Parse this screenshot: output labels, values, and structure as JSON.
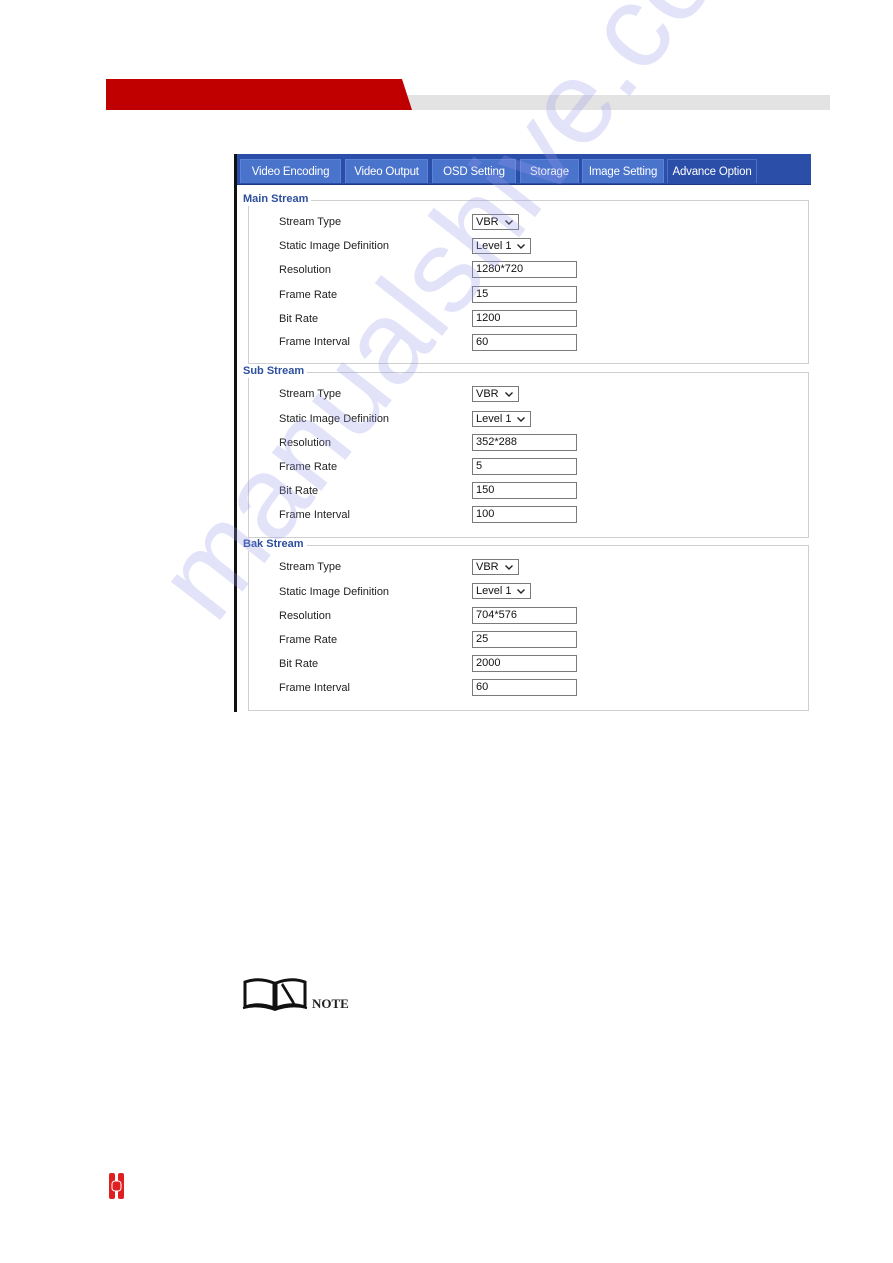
{
  "header": {
    "brand_color": "#c00000",
    "band_color": "#e3e3e3"
  },
  "tabs": [
    {
      "label": "Video Encoding",
      "active": false
    },
    {
      "label": "Video Output",
      "active": false
    },
    {
      "label": "OSD Setting",
      "active": false
    },
    {
      "label": "Storage",
      "active": false
    },
    {
      "label": "Image Setting",
      "active": false
    },
    {
      "label": "Advance Option",
      "active": true
    }
  ],
  "streams": [
    {
      "title": "Main Stream",
      "fields": {
        "stream_type": {
          "label": "Stream Type",
          "value": "VBR"
        },
        "static_image_definition": {
          "label": "Static Image Definition",
          "value": "Level 1"
        },
        "resolution": {
          "label": "Resolution",
          "value": "1280*720"
        },
        "frame_rate": {
          "label": "Frame Rate",
          "value": "15"
        },
        "bit_rate": {
          "label": "Bit Rate",
          "value": "1200"
        },
        "frame_interval": {
          "label": "Frame Interval",
          "value": "60"
        }
      }
    },
    {
      "title": "Sub Stream",
      "fields": {
        "stream_type": {
          "label": "Stream Type",
          "value": "VBR"
        },
        "static_image_definition": {
          "label": "Static Image Definition",
          "value": "Level 1"
        },
        "resolution": {
          "label": "Resolution",
          "value": "352*288"
        },
        "frame_rate": {
          "label": "Frame Rate",
          "value": "5"
        },
        "bit_rate": {
          "label": "Bit Rate",
          "value": "150"
        },
        "frame_interval": {
          "label": "Frame Interval",
          "value": "100"
        }
      }
    },
    {
      "title": "Bak Stream",
      "fields": {
        "stream_type": {
          "label": "Stream Type",
          "value": "VBR"
        },
        "static_image_definition": {
          "label": "Static Image Definition",
          "value": "Level 1"
        },
        "resolution": {
          "label": "Resolution",
          "value": "704*576"
        },
        "frame_rate": {
          "label": "Frame Rate",
          "value": "25"
        },
        "bit_rate": {
          "label": "Bit Rate",
          "value": "2000"
        },
        "frame_interval": {
          "label": "Frame Interval",
          "value": "60"
        }
      }
    }
  ],
  "note": {
    "label": "NOTE",
    "icon": "open-book-pen-icon"
  },
  "watermark": "manualshive.com",
  "footer": {
    "logo_icon": "company-logo-icon"
  }
}
